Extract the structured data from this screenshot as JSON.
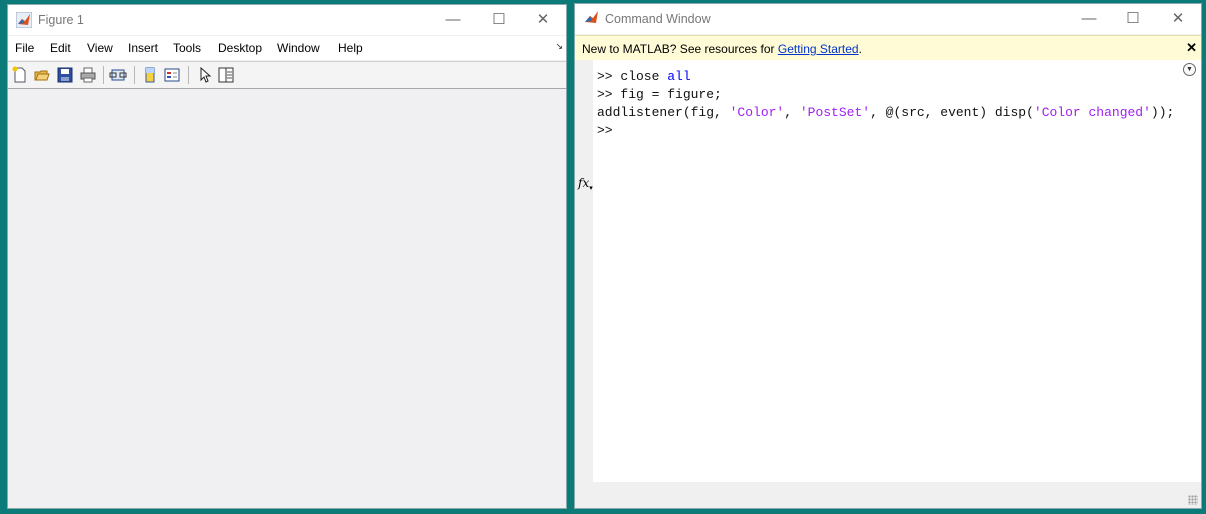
{
  "figure_window": {
    "title": "Figure 1",
    "menu": [
      "File",
      "Edit",
      "View",
      "Insert",
      "Tools",
      "Desktop",
      "Window",
      "Help"
    ],
    "toolbar_icons": [
      "new-figure-icon",
      "open-file-icon",
      "save-icon",
      "print-icon",
      "link-plot-icon",
      "insert-colorbar-icon",
      "insert-legend-icon",
      "edit-plot-icon",
      "property-inspector-icon"
    ]
  },
  "command_window": {
    "title": "Command Window",
    "banner_text": "New to MATLAB? See resources for ",
    "banner_link": "Getting Started",
    "banner_end": ".",
    "lines": [
      {
        "prompt": ">> ",
        "code": "close ",
        "kw": "all"
      },
      {
        "prompt": ">> ",
        "code": "fig = figure;"
      },
      {
        "p1": "addlistener(fig, ",
        "s1": "'Color'",
        "p2": ", ",
        "s2": "'PostSet'",
        "p3": ", @(src, event) disp(",
        "s3": "'Color changed'",
        "p4": "));"
      },
      {
        "prompt": ">>"
      }
    ],
    "fx_label": "fx"
  },
  "colors": {
    "desktop": "#0b7a78",
    "keyword": "#0000ff",
    "string": "#a020f0",
    "banner_bg": "#fffbd6"
  }
}
